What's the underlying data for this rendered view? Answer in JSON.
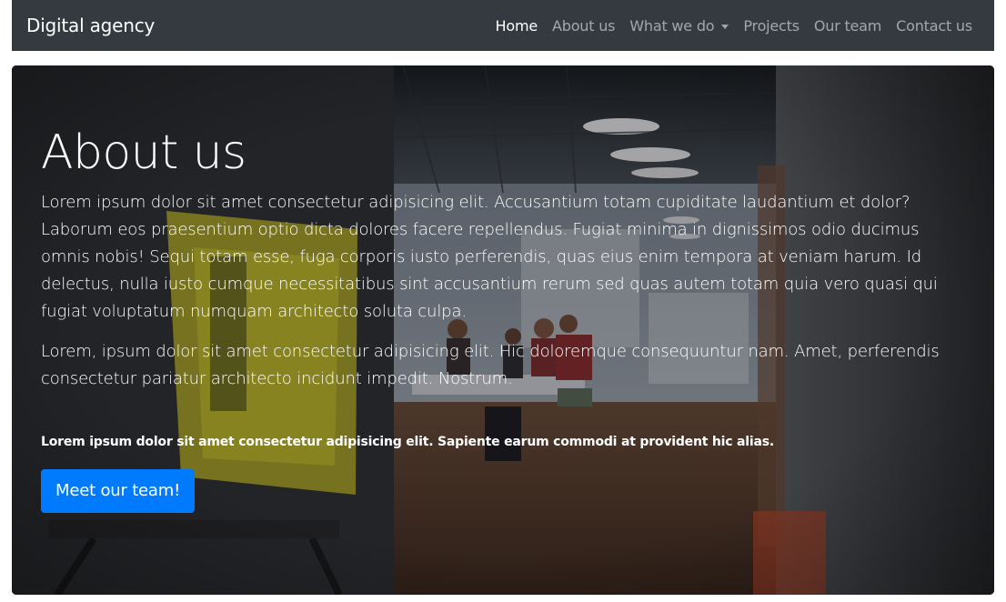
{
  "navbar": {
    "brand": "Digital agency",
    "items": [
      {
        "label": "Home",
        "active": true
      },
      {
        "label": "About us",
        "active": false
      },
      {
        "label": "What we do",
        "active": false,
        "dropdown": true
      },
      {
        "label": "Projects",
        "active": false
      },
      {
        "label": "Our team",
        "active": false
      },
      {
        "label": "Contact us",
        "active": false
      }
    ]
  },
  "hero": {
    "title": "About us",
    "paragraph1": "Lorem ipsum dolor sit amet consectetur adipisicing elit. Accusantium totam cupiditate laudantium et dolor? Laborum eos praesentium optio dicta dolores facere repellendus. Fugiat minima in dignissimos odio ducimus omnis nobis! Sequi totam esse, fuga corporis iusto perferendis, quas eius enim tempora at veniam harum. Id delectus, nulla iusto cumque necessitatibus sint accusantium rerum sed quas autem totam quia vero quasi qui fugiat voluptatum numquam architecto soluta culpa.",
    "paragraph2": "Lorem, ipsum dolor sit amet consectetur adipisicing elit. Hic doloremque consequuntur nam. Amet, perferendis consectetur pariatur architecto incidunt impedit. Nostrum.",
    "small_text": "Lorem ipsum dolor sit amet consectetur adipisicing elit. Sapiente earum commodi at provident hic alias.",
    "button_label": "Meet our team!"
  },
  "colors": {
    "navbar_bg": "#343a40",
    "button_bg": "#007bff",
    "text": "#ffffff"
  },
  "icons": {
    "dropdown_caret": "chevron-down-icon"
  }
}
